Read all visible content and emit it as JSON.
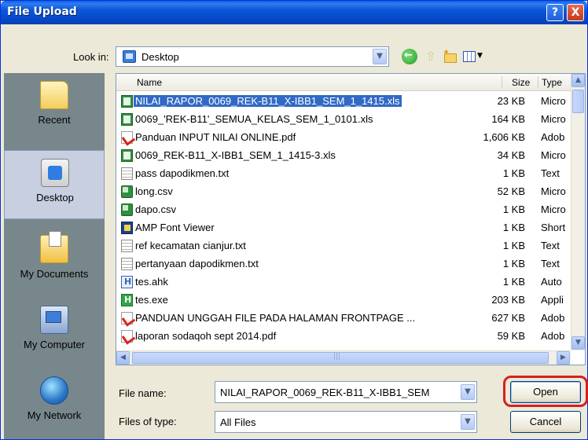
{
  "window": {
    "title": "File Upload"
  },
  "titlebar": {
    "help": "?",
    "close": "X"
  },
  "lookin": {
    "label": "Look in:",
    "value": "Desktop"
  },
  "places": [
    {
      "label": "Recent"
    },
    {
      "label": "Desktop"
    },
    {
      "label": "My Documents"
    },
    {
      "label": "My Computer"
    },
    {
      "label": "My Network"
    }
  ],
  "columns": {
    "name": "Name",
    "size": "Size",
    "type": "Type"
  },
  "files": [
    {
      "name": "NILAI_RAPOR_0069_REK-B11_X-IBB1_SEM_1_1415.xls",
      "size": "23 KB",
      "type": "Micro",
      "icon": "xls-icon"
    },
    {
      "name": "0069_'REK-B11'_SEMUA_KELAS_SEM_1_0101.xls",
      "size": "164 KB",
      "type": "Micro",
      "icon": "xls-icon"
    },
    {
      "name": "Panduan INPUT NILAI ONLINE.pdf",
      "size": "1,606 KB",
      "type": "Adob",
      "icon": "pdf-icon"
    },
    {
      "name": "0069_REK-B11_X-IBB1_SEM_1_1415-3.xls",
      "size": "34 KB",
      "type": "Micro",
      "icon": "xls-icon"
    },
    {
      "name": "pass dapodikmen.txt",
      "size": "1 KB",
      "type": "Text",
      "icon": "text-file-icon"
    },
    {
      "name": "long.csv",
      "size": "52 KB",
      "type": "Micro",
      "icon": "csv-icon"
    },
    {
      "name": "dapo.csv",
      "size": "1 KB",
      "type": "Micro",
      "icon": "csv-icon"
    },
    {
      "name": "AMP Font Viewer",
      "size": "1 KB",
      "type": "Short",
      "icon": "app-shortcut-icon"
    },
    {
      "name": "ref kecamatan cianjur.txt",
      "size": "1 KB",
      "type": "Text",
      "icon": "text-file-icon"
    },
    {
      "name": "pertanyaan dapodikmen.txt",
      "size": "1 KB",
      "type": "Text",
      "icon": "text-file-icon"
    },
    {
      "name": "tes.ahk",
      "size": "1 KB",
      "type": "Auto",
      "icon": "ahk-script-icon"
    },
    {
      "name": "tes.exe",
      "size": "203 KB",
      "type": "Appli",
      "icon": "exe-icon"
    },
    {
      "name": "PANDUAN UNGGAH FILE PADA HALAMAN FRONTPAGE ...",
      "size": "627 KB",
      "type": "Adob",
      "icon": "pdf-icon"
    },
    {
      "name": "laporan sodaqoh sept 2014.pdf",
      "size": "59 KB",
      "type": "Adob",
      "icon": "pdf-icon"
    }
  ],
  "filename": {
    "label": "File name:",
    "value": "NILAI_RAPOR_0069_REK-B11_X-IBB1_SEM"
  },
  "filetype": {
    "label": "Files of type:",
    "value": "All Files"
  },
  "buttons": {
    "open": "Open",
    "cancel": "Cancel"
  },
  "colors": {
    "titlebar": "#0a53d8",
    "selection": "#316ac5",
    "highlight_ring": "#d62020"
  }
}
